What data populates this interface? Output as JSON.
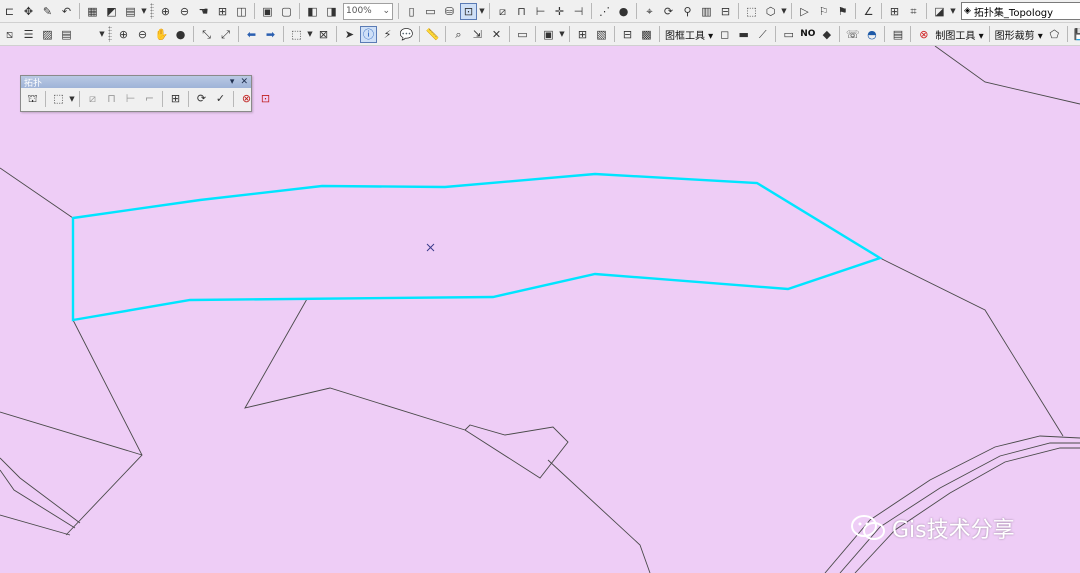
{
  "toolbar_row1": {
    "zoom_level": "100%",
    "topology_select": "拓扑集_Topology"
  },
  "toolbar_row2": {
    "frame_tools_label": "图框工具",
    "no_label": "NO",
    "map_tools_label": "制图工具",
    "clip_label": "图形裁剪"
  },
  "topology_panel": {
    "title": "拓扑"
  },
  "watermark": {
    "text": "Gis技术分享"
  },
  "colors": {
    "map_background": "#eecdf6",
    "selected_outline": "#00e5ff",
    "boundary_line": "#4a4a4a"
  }
}
